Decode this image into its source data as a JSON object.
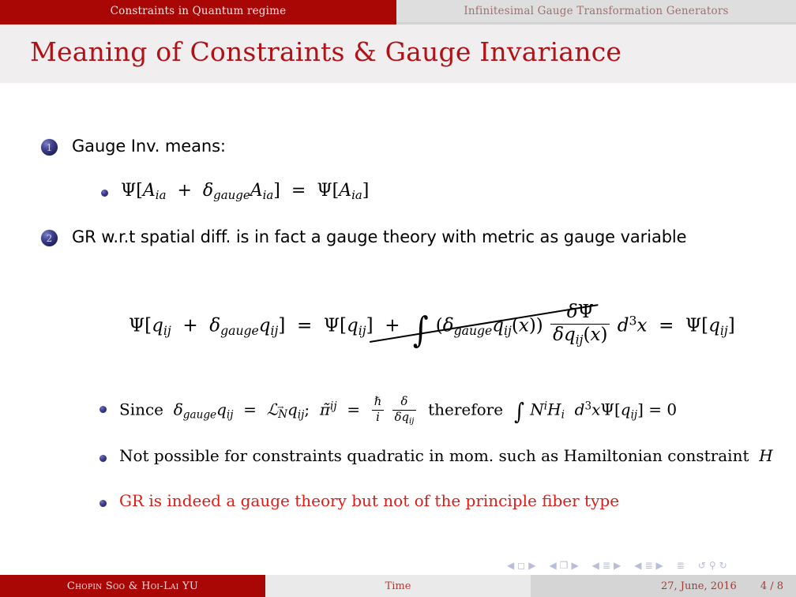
{
  "header": {
    "active_section": "Constraints in Quantum regime",
    "inactive_section": "Infinitesimal Gauge Transformation Generators",
    "active_bg": "#a90606",
    "inactive_bg": "#dedede"
  },
  "title": "Meaning of Constraints & Gauge Invariance",
  "title_color": "#b01217",
  "body": {
    "item1": {
      "number": "1",
      "text": "Gauge Inv. means:",
      "sub1": {
        "psi": "Ψ",
        "open": "[",
        "A1": "A",
        "A1sub": "ia",
        "plus": "+",
        "delta": "δ",
        "deltasub": "gauge",
        "A2": "A",
        "A2sub": "ia",
        "close": "]",
        "equals": "=",
        "psi2": "Ψ",
        "open2": "[",
        "A3": "A",
        "A3sub": "ia",
        "close2": "]"
      }
    },
    "item2": {
      "number": "2",
      "text": "GR w.r.t spatial diff. is in fact a gauge theory with metric as gauge variable"
    },
    "main_equation": {
      "psi": "Ψ",
      "q": "q",
      "qsub": "ij",
      "plus": "+",
      "delta": "δ",
      "gauge": "gauge",
      "equals": "=",
      "integral": "∫",
      "x": "x",
      "d": "d",
      "exp3": "3",
      "struck_through": true
    },
    "sub_items": [
      {
        "id": "since",
        "prefix": "Since",
        "middle": "therefore",
        "suffix": "= 0",
        "color": "#000000"
      },
      {
        "id": "not-possible",
        "text": "Not possible for constraints quadratic in mom. such as Hamiltonian constraint",
        "trailing_math": "H",
        "color": "#000000"
      },
      {
        "id": "gr-gauge-theory",
        "text": "GR is indeed a gauge theory but not of the principle fiber type",
        "color": "#e01b16"
      }
    ]
  },
  "navigation": {
    "icons": [
      "prev-slide-icon",
      "slide-icon",
      "next-slide-icon",
      "prev-frame-icon",
      "frame-icon",
      "next-frame-icon",
      "prev-subsection-icon",
      "subsection-icon",
      "next-subsection-icon",
      "prev-section-icon",
      "section-icon",
      "next-section-icon",
      "doc-icon",
      "back-icon",
      "search-icon",
      "forward-icon"
    ]
  },
  "footer": {
    "author": "Chopin Soo & Hoi-Lai YU",
    "center": "Time",
    "date": "27, June, 2016",
    "page": "4 / 8",
    "author_bg": "#a90606",
    "center_bg": "#eaeaea",
    "right_bg": "#d5d5d5"
  }
}
